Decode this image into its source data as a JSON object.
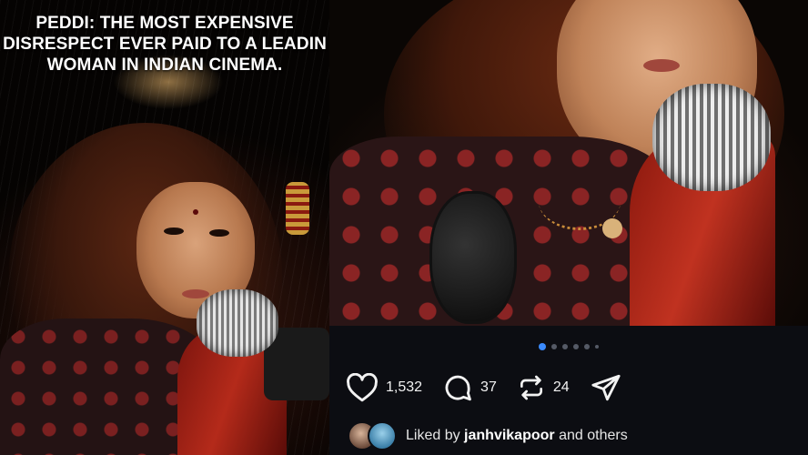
{
  "poster": {
    "title": "PEDDI: THE MOST EXPENSIVE\nDISRESPECT EVER PAID TO A LEADIN\nWOMAN IN INDIAN CINEMA."
  },
  "post": {
    "carousel": {
      "total": 6,
      "active_index": 0
    },
    "actions": {
      "likes": "1,532",
      "comments": "37",
      "reposts": "24",
      "like_icon": "heart-icon",
      "comment_icon": "comment-bubble-icon",
      "repost_icon": "repost-icon",
      "share_icon": "send-icon"
    },
    "liked_by": {
      "prefix": "Liked by",
      "username": "janhvikapoor",
      "suffix": "and others"
    }
  },
  "colors": {
    "background": "#0c0d12",
    "accent": "#3b8bff",
    "text": "#f2f2f2"
  }
}
